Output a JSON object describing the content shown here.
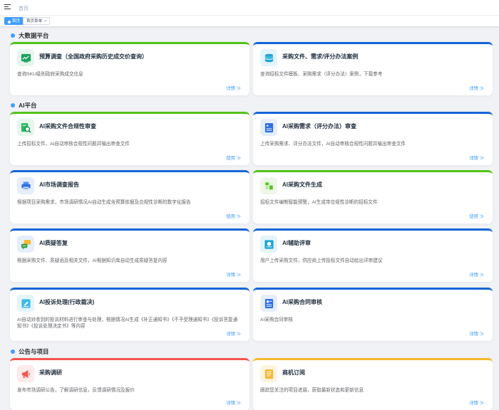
{
  "header": {
    "breadcrumb": "首页"
  },
  "tags": [
    {
      "label": "首页"
    },
    {
      "label": "首页菜单",
      "close": "×"
    }
  ],
  "sections": {
    "bigdata": "大数据平台",
    "ai": "AI平台",
    "notice": "公告与项目"
  },
  "colors": {
    "accent": "#409eff",
    "green": "#52c41a",
    "red": "#f5544f",
    "orange": "#f5b830"
  },
  "cards": [
    {
      "title": "预算调查（全国政府采购历史成交价查询）",
      "desc": "查询SKU级别政府采购成交信息",
      "link": "详情 ≫",
      "icon": "chart-icon"
    },
    {
      "title": "采购文件、需求/评分办法案例",
      "desc": "查询招标文件模板、采购需求（评分办法）案例，下载参考",
      "link": "详情 ≫",
      "icon": "database-icon"
    },
    {
      "title": "AI采购文件合规性审查",
      "desc": "上传招标文件，AI自动审核合规性问题并输出审查文件",
      "link": "使用 ≫",
      "icon": "file-search-icon"
    },
    {
      "title": "AI采购需求（评分办法）审查",
      "desc": "上传采购需求、评分办法文件，AI自动审核合规性问题并输出审查文件",
      "link": "详情 ≫",
      "icon": "calculator-doc-icon"
    },
    {
      "title": "AI市场调查报告",
      "desc": "根据项目采购需求，市场调研情况AI自动生成含预算依据及合规性诊断的数字化报告",
      "link": "使用 ≫",
      "icon": "printer-icon"
    },
    {
      "title": "AI采购文件生成",
      "desc": "招标文件编制智能预警，AI生成带合规性诊断的招标文件",
      "link": "使用 ≫",
      "icon": "bid-doc-icon"
    },
    {
      "title": "AI质疑答复",
      "desc": "根据采购文件、质疑函及相关文件，AI根据知识库自动生成质疑答复内容",
      "link": "详情 ≫",
      "icon": "chat-bubbles-icon"
    },
    {
      "title": "AI辅助评审",
      "desc": "用户上传采购文件，供应商上传投标文件自动给出评审建议",
      "link": "详情 ≫",
      "icon": "review-card-icon"
    },
    {
      "title": "AI投诉处理(行政裁决)",
      "desc": "AI自动对收到的投诉材料进行审查与处理，根据情况AI生成《补正通知书》《不予受理通知书》《投诉答复通知书》《投诉处理决定书》等内容",
      "link": "详情 ≫",
      "icon": "gavel-icon"
    },
    {
      "title": "AI采购合同审核",
      "desc": "AI采购合同审核",
      "link": "详情 ≫",
      "icon": "contract-icon"
    },
    {
      "title": "采购调研",
      "desc": "发布市场调研公告，了解调研信息，反馈调研情况及报价",
      "link": "详情 ≫",
      "icon": "megaphone-icon"
    },
    {
      "title": "商机订阅",
      "desc": "跟踪您关注的项目进展，获取最新状态和更新信息",
      "link": "详情 ≫",
      "icon": "notebook-icon"
    }
  ]
}
